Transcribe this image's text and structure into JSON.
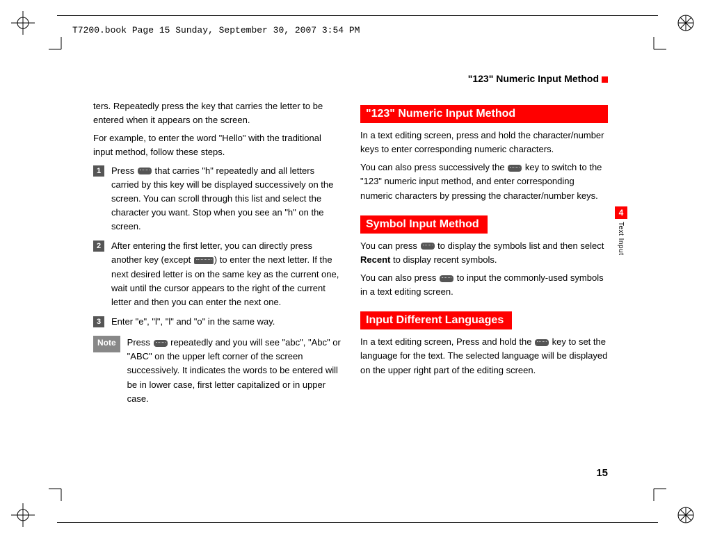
{
  "doc_header": "T7200.book  Page 15  Sunday, September 30, 2007  3:54 PM",
  "running_head": "\"123\" Numeric Input Method",
  "side_tab_num": "4",
  "side_tab_label": "Text Input",
  "page_number": "15",
  "col1": {
    "intro1": "ters. Repeatedly press the key that carries the letter to be entered when it appears on the screen.",
    "intro2": "For example, to enter the word \"Hello\" with the traditional input method, follow these steps.",
    "step1_a": "Press ",
    "step1_b": " that carries \"h\" repeatedly and all letters carried by this key will be displayed successively on the screen. You can scroll through this list and select the character you want. Stop when you see an \"h\" on the screen.",
    "step2_a": "After entering the first letter, you can directly press another key (except ",
    "step2_b": ") to enter the next letter. If the next desired letter is on the same key as the current one, wait until the cursor appears to the right of the current letter and then you can enter the next one.",
    "step3": "Enter \"e\", \"l\", \"l\" and \"o\" in the same way.",
    "note_label": "Note",
    "note_a": "Press ",
    "note_b": " repeatedly and you will see \"abc\", \"Abc\" or \"ABC\" on the upper left corner of the screen successively. It indicates the words to be entered will be in lower case, first letter capitalized or in upper case."
  },
  "col2": {
    "h1": " \"123\" Numeric Input Method",
    "p1": "In a text editing screen, press and hold the character/number keys to enter corresponding numeric characters.",
    "p2_a": "You can also press successively the ",
    "p2_b": " key to switch to the \"123\" numeric input method, and enter corresponding numeric characters by pressing the character/number keys.",
    "h2": " Symbol Input Method",
    "p3_a": "You can press ",
    "p3_b": " to display the symbols list and then select ",
    "p3_bold": "Recent",
    "p3_c": " to display recent symbols.",
    "p4_a": "You can also press ",
    "p4_b": " to input the commonly-used symbols in a text editing screen.",
    "h3": " Input Different Languages",
    "p5_a": "In a text editing screen, Press and hold the ",
    "p5_b": " key to set the language for the text. The selected language will be displayed on the upper right part of the editing screen."
  }
}
